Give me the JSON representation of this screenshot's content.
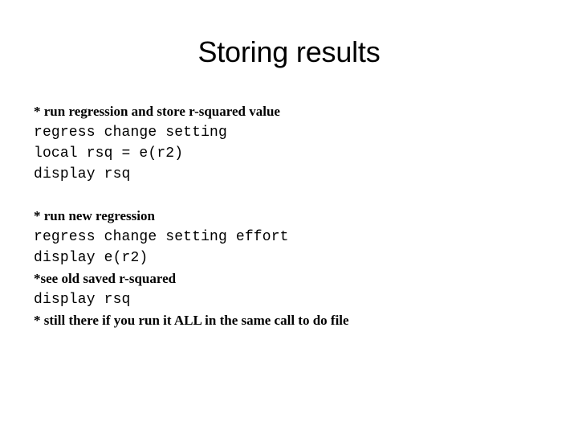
{
  "slide": {
    "title": "Storing results",
    "background_color": "#ffffff",
    "text_color": "#000000",
    "lines": [
      {
        "text": "* run regression and store r-squared value",
        "style": "comment"
      },
      {
        "text": "regress change setting",
        "style": "code"
      },
      {
        "text": "local rsq = e(r2)",
        "style": "code"
      },
      {
        "text": "display rsq",
        "style": "code"
      },
      {
        "text": "",
        "style": "blank"
      },
      {
        "text": "* run new regression",
        "style": "comment"
      },
      {
        "text": "regress change setting effort",
        "style": "code"
      },
      {
        "text": "display e(r2)",
        "style": "code"
      },
      {
        "text": "*see old saved r-squared",
        "style": "comment"
      },
      {
        "text": "display rsq",
        "style": "code"
      },
      {
        "text": "* still there if you run it ALL in the same call to do file",
        "style": "comment"
      }
    ]
  }
}
